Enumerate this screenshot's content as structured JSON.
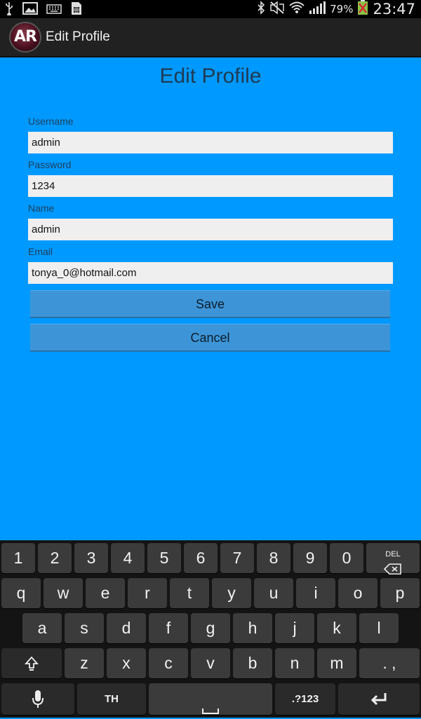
{
  "status_bar": {
    "battery_percent": "79%",
    "time": "23:47",
    "icons": [
      "usb-icon",
      "image-icon",
      "keyboard-icon",
      "sim-icon",
      "bluetooth-icon",
      "mute-icon",
      "wifi-icon",
      "signal-icon",
      "battery-icon"
    ]
  },
  "app_bar": {
    "logo_text": "AR",
    "title": "Edit Profile"
  },
  "form": {
    "heading": "Edit Profile",
    "username_label": "Username",
    "username_value": "admin",
    "password_label": "Password",
    "password_value": "1234",
    "name_label": "Name",
    "name_value": "admin",
    "email_label": "Email",
    "email_value": "tonya_0@hotmail.com",
    "save_label": "Save",
    "cancel_label": "Cancel"
  },
  "keyboard": {
    "row1": [
      "1",
      "2",
      "3",
      "4",
      "5",
      "6",
      "7",
      "8",
      "9",
      "0"
    ],
    "del_label": "DEL",
    "row2": [
      "q",
      "w",
      "e",
      "r",
      "t",
      "y",
      "u",
      "i",
      "o",
      "p"
    ],
    "row3": [
      "a",
      "s",
      "d",
      "f",
      "g",
      "h",
      "j",
      "k",
      "l"
    ],
    "row4": [
      "z",
      "x",
      "c",
      "v",
      "b",
      "n",
      "m"
    ],
    "punct_label": ". ,",
    "lang_label": "TH",
    "symbols_label": ".?123"
  },
  "colors": {
    "background": "#0099ff",
    "input_bg": "#efefef",
    "button_bg": "#3d95d8",
    "keyboard_bg": "#141414",
    "key_bg": "#3b3b3b"
  }
}
